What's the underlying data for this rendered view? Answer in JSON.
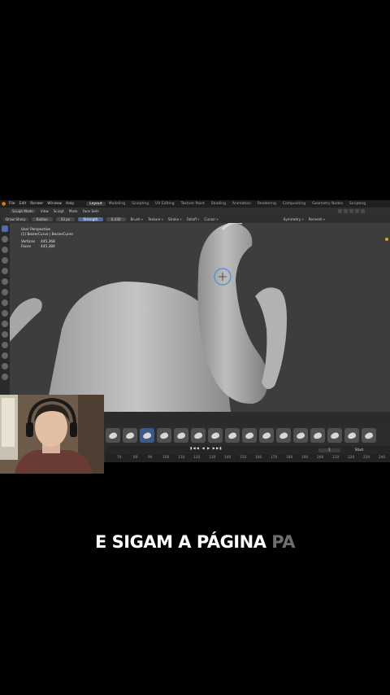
{
  "menubar": {
    "items": [
      "File",
      "Edit",
      "Render",
      "Window",
      "Help"
    ],
    "workspaces": [
      "Layout",
      "Modeling",
      "Sculpting",
      "UV Editing",
      "Texture Paint",
      "Shading",
      "Animation",
      "Rendering",
      "Compositing",
      "Geometry Nodes",
      "Scripting"
    ],
    "active_workspace": "Layout"
  },
  "header": {
    "mode": "Sculpt Mode",
    "menus": [
      "View",
      "Sculpt",
      "Mask",
      "Face Sets"
    ]
  },
  "toolsettings": {
    "brush": "Draw Sharp",
    "radius_label": "Radius",
    "radius_value": "33 px",
    "strength_label": "Strength",
    "strength_value": "0.430",
    "menus": [
      "Brush",
      "Texture",
      "Stroke",
      "Falloff",
      "Cursor"
    ],
    "symmetry_label": "Symmetry",
    "remesh_label": "Remesh"
  },
  "viewport": {
    "view_name": "User Perspective",
    "object_name": "(1) BezierCurve | BezierCurve",
    "stats": [
      {
        "label": "Vertices",
        "value": "445,368"
      },
      {
        "label": "Faces",
        "value": "445,384"
      }
    ]
  },
  "timeline": {
    "current_frame": "1",
    "playback_label": "Start",
    "ruler_ticks": [
      "70",
      "80",
      "90",
      "100",
      "110",
      "120",
      "130",
      "140",
      "150",
      "160",
      "170",
      "180",
      "190",
      "200",
      "210",
      "220",
      "230",
      "240"
    ]
  },
  "caption": {
    "solid": "E SIGAM A PÁGINA ",
    "fading": "PA"
  },
  "colors": {
    "accent": "#4b6da8",
    "background": "#000000",
    "viewport": "#3d3d3d"
  }
}
